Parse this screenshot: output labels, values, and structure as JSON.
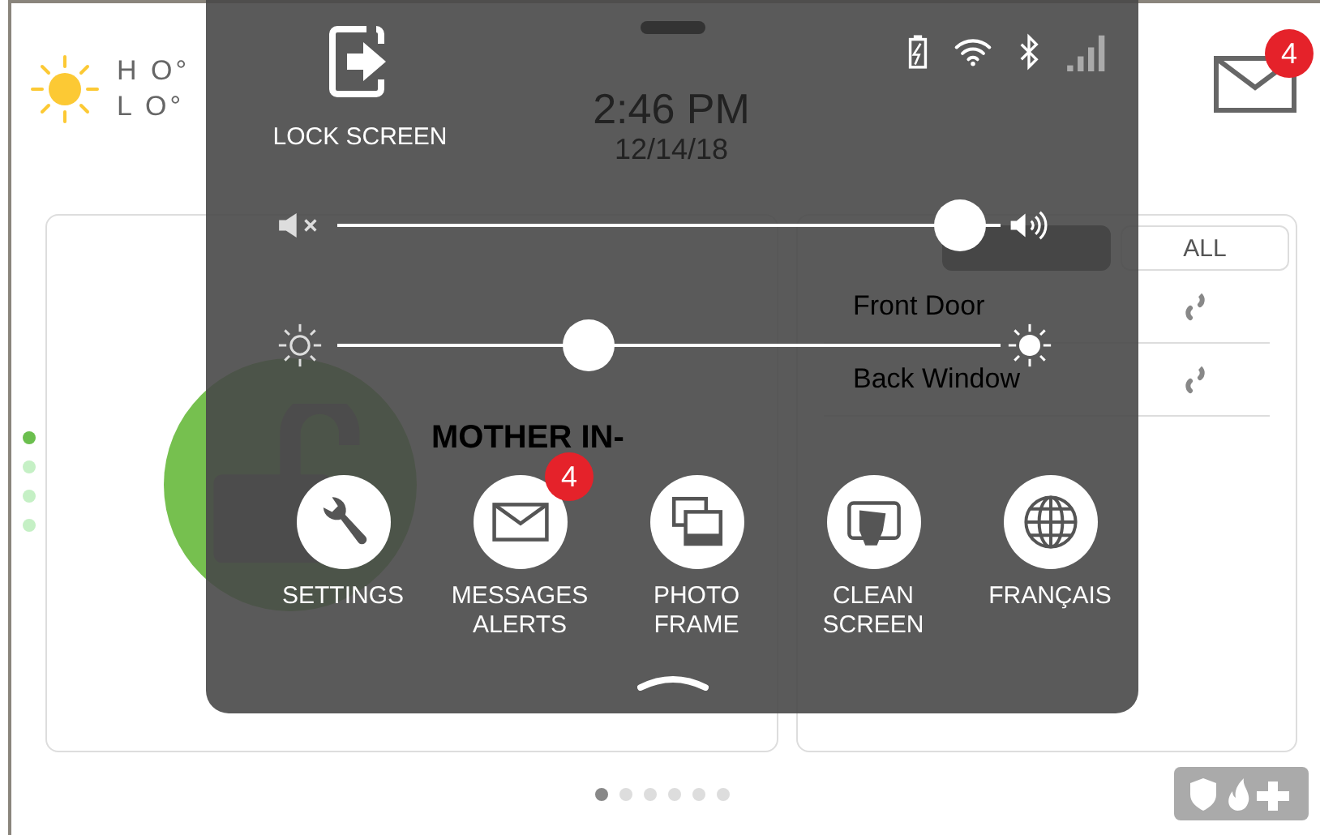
{
  "weather": {
    "high": "H O°",
    "low": "L O°"
  },
  "mail": {
    "badge": "4"
  },
  "side_pager": [
    {
      "selected": true
    },
    {
      "selected": false
    },
    {
      "selected": false
    },
    {
      "selected": false
    }
  ],
  "partition": {
    "name_line": "MOTHER IN-"
  },
  "sensors": {
    "tabs": [
      {
        "selected": true
      },
      {
        "label": "ALL",
        "selected": false
      }
    ],
    "rows": [
      {
        "name": "Front Door"
      },
      {
        "name": "Back Window"
      }
    ]
  },
  "page_dots": [
    {
      "selected": true
    },
    {
      "selected": false
    },
    {
      "selected": false
    },
    {
      "selected": false
    },
    {
      "selected": false
    },
    {
      "selected": false
    }
  ],
  "overlay": {
    "lock_label": "LOCK SCREEN",
    "time": "2:46 PM",
    "date": "12/14/18",
    "sliders": [
      {
        "kind": "volume",
        "level": 0.94
      },
      {
        "kind": "brightness",
        "level": 0.38
      }
    ],
    "shortcuts": [
      {
        "kind": "settings",
        "lines": [
          "SETTINGS"
        ]
      },
      {
        "kind": "messages",
        "lines": [
          "MESSAGES",
          "ALERTS"
        ],
        "badge": "4"
      },
      {
        "kind": "photo",
        "lines": [
          "PHOTO",
          "FRAME"
        ]
      },
      {
        "kind": "clean",
        "lines": [
          "CLEAN",
          "SCREEN"
        ]
      },
      {
        "kind": "language",
        "lines": [
          "FRANÇAIS"
        ]
      }
    ]
  }
}
